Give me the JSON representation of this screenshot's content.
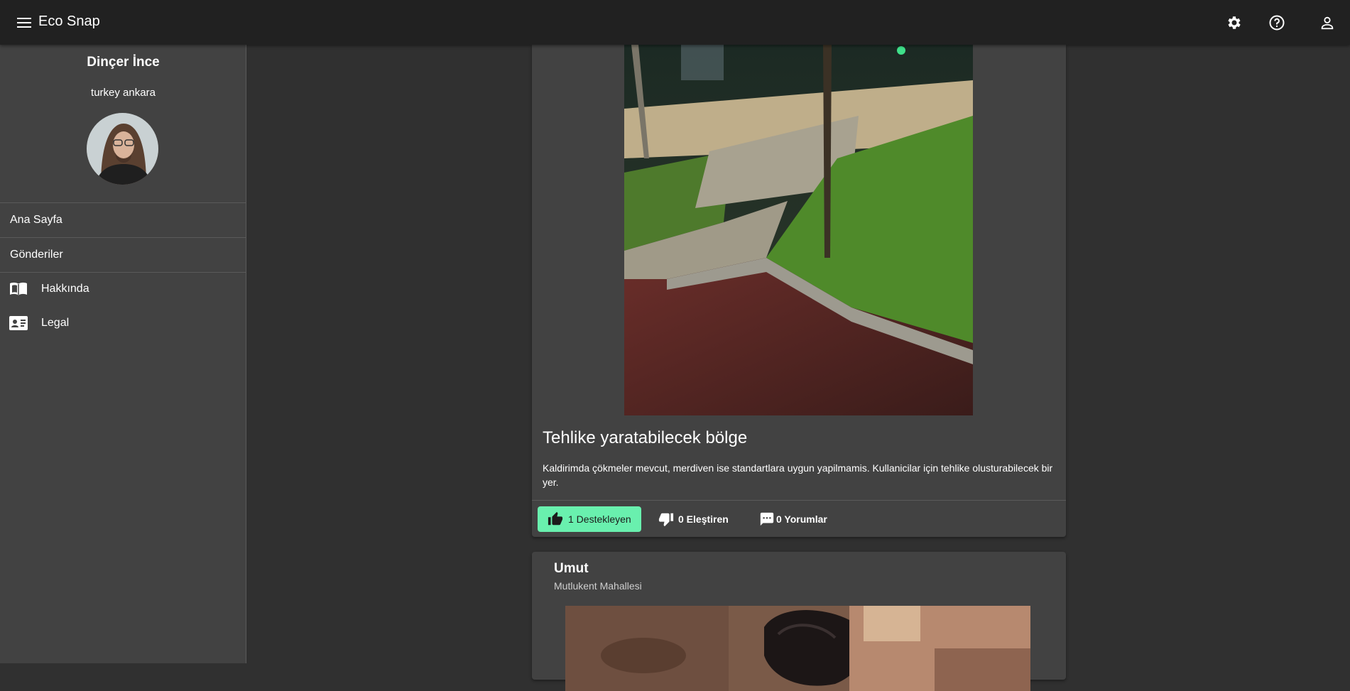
{
  "app": {
    "title": "Eco Snap",
    "icons": [
      "menu-icon",
      "settings-icon",
      "help-icon",
      "account-icon"
    ]
  },
  "profile": {
    "name": "Dinçer İnce",
    "location": "turkey ankara"
  },
  "nav": {
    "home": "Ana Sayfa",
    "posts": "Gönderiler",
    "about": "Hakkında",
    "legal": "Legal"
  },
  "posts": [
    {
      "title": "Tehlike yaratabilecek bölge",
      "description": "Kaldirimda çökmeler mevcut, merdiven ise standartlara uygun yapilmamis. Kullanicilar için tehlike olusturabilecek bir yer.",
      "support_label": "1 Destekleyen",
      "criticize_label": "0 Eleştiren",
      "comments_label": "0 Yorumlar"
    },
    {
      "author": "Umut",
      "location": "Mutlukent Mahallesi"
    }
  ],
  "colors": {
    "topbar": "#212121",
    "sidebar": "#424242",
    "background": "#303030",
    "card": "#424242",
    "accent": "#69f0ae"
  }
}
